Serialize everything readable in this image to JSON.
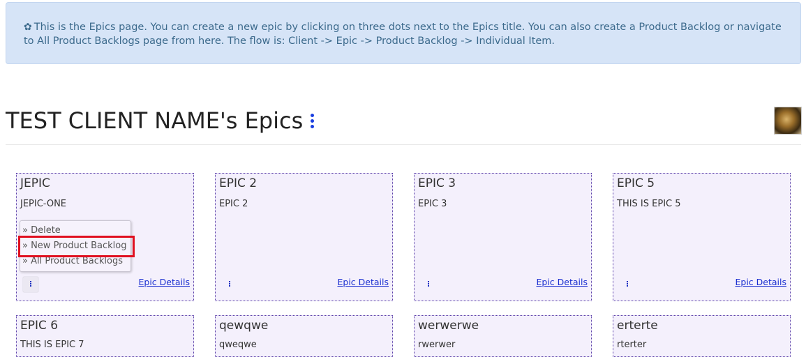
{
  "alert": {
    "icon": "gear-icon",
    "text": "This is the Epics page. You can create a new epic by clicking on three dots next to the Epics title. You can also create a Product Backlog or navigate to All Product Backlogs page from here. The flow is: Client -> Epic -> Product Backlog -> Individual Item."
  },
  "page": {
    "title": "TEST CLIENT NAME's Epics"
  },
  "epics": [
    {
      "title": "JEPIC",
      "description": "JEPIC-ONE",
      "link": "Epic Details"
    },
    {
      "title": "EPIC 2",
      "description": "EPIC 2",
      "link": "Epic Details"
    },
    {
      "title": "EPIC 3",
      "description": "EPIC 3",
      "link": "Epic Details"
    },
    {
      "title": "EPIC 5",
      "description": "THIS IS EPIC 5",
      "link": "Epic Details"
    },
    {
      "title": "EPIC 6",
      "description": "THIS IS EPIC 7"
    },
    {
      "title": "qewqwe",
      "description": "qweqwe"
    },
    {
      "title": "werwerwe",
      "description": "rwerwer"
    },
    {
      "title": "erterte",
      "description": "rterter"
    }
  ],
  "dropdown": {
    "items": [
      "» Delete",
      "» New Product Backlog",
      "» All Product Backlogs"
    ]
  },
  "colors": {
    "alert_bg": "#d6e4f7",
    "card_bg": "#f4f0fc",
    "link": "#1a2fd0",
    "highlight": "#e01020"
  }
}
